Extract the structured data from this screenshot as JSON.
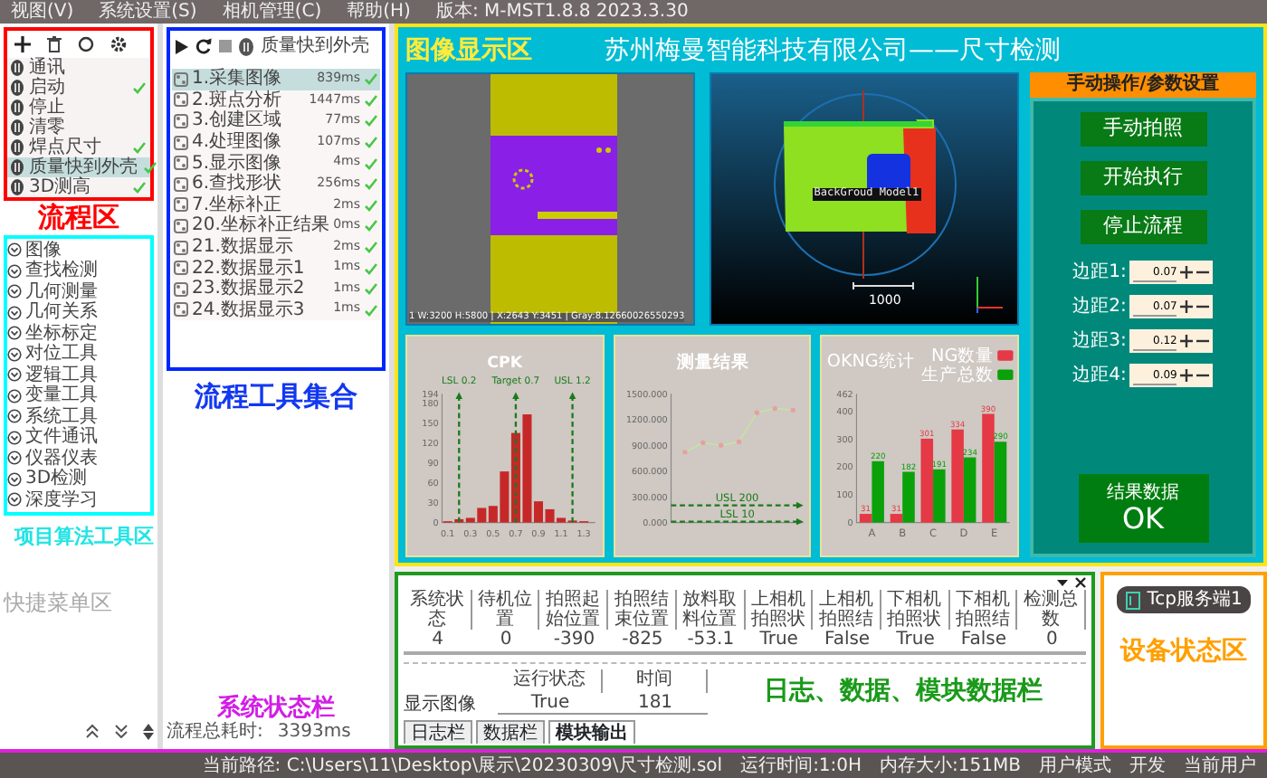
{
  "menu_bar": {
    "items": [
      "视图(V)",
      "系统设置(S)",
      "相机管理(C)",
      "帮助(H)"
    ],
    "version": "版本: M-MST1.8.8 2023.3.30"
  },
  "flow_area": {
    "label": "流程区",
    "flows": [
      {
        "name": "通讯",
        "checked": false,
        "selected": false
      },
      {
        "name": "启动",
        "checked": true,
        "selected": false
      },
      {
        "name": "停止",
        "checked": false,
        "selected": false
      },
      {
        "name": "清零",
        "checked": false,
        "selected": false
      },
      {
        "name": "焊点尺寸",
        "checked": true,
        "selected": false
      },
      {
        "name": "质量快到外壳",
        "checked": true,
        "selected": true
      },
      {
        "name": "3D测高",
        "checked": true,
        "selected": false
      }
    ]
  },
  "algorithm_tools": {
    "label": "项目算法工具区",
    "items": [
      "图像",
      "查找检测",
      "几何测量",
      "几何关系",
      "坐标标定",
      "对位工具",
      "逻辑工具",
      "变量工具",
      "系统工具",
      "文件通讯",
      "仪器仪表",
      "3D检测",
      "深度学习"
    ]
  },
  "shortcut_menu": {
    "label": "快捷菜单区"
  },
  "process_tools": {
    "header": "质量快到外壳",
    "label": "流程工具集合",
    "tools": [
      {
        "name": "1.采集图像",
        "time": "839ms",
        "checked": true,
        "selected": true
      },
      {
        "name": "2.斑点分析",
        "time": "1447ms",
        "checked": true,
        "selected": false
      },
      {
        "name": "3.创建区域",
        "time": "77ms",
        "checked": true,
        "selected": false
      },
      {
        "name": "4.处理图像",
        "time": "107ms",
        "checked": true,
        "selected": false
      },
      {
        "name": "5.显示图像",
        "time": "4ms",
        "checked": true,
        "selected": false
      },
      {
        "name": "6.查找形状",
        "time": "256ms",
        "checked": true,
        "selected": false
      },
      {
        "name": "7.坐标补正",
        "time": "2ms",
        "checked": true,
        "selected": false
      },
      {
        "name": "20.坐标补正结果",
        "time": "0ms",
        "checked": true,
        "selected": false
      },
      {
        "name": "21.数据显示",
        "time": "2ms",
        "checked": true,
        "selected": false
      },
      {
        "name": "22.数据显示1",
        "time": "1ms",
        "checked": true,
        "selected": false
      },
      {
        "name": "23.数据显示2",
        "time": "1ms",
        "checked": true,
        "selected": false
      },
      {
        "name": "24.数据显示3",
        "time": "1ms",
        "checked": true,
        "selected": false
      }
    ],
    "total_time_label": "流程总耗时:",
    "total_time": "3393ms"
  },
  "system_status_label": "系统状态栏",
  "display": {
    "label": "图像显示区",
    "title": "苏州梅曼智能科技有限公司——尺寸检测",
    "image_info": "1 W:3200 H:5800 | X:2643 Y:3451 | Gray:8.12660026550293",
    "model_label": "BackGroud Model1",
    "scale_label": "1000",
    "charts": [
      {
        "chart_data": {
          "type": "bar",
          "title": "CPK",
          "x": [
            0.1,
            0.2,
            0.3,
            0.4,
            0.5,
            0.6,
            0.7,
            0.8,
            0.9,
            1.0,
            1.1,
            1.2,
            1.3
          ],
          "values": [
            2,
            5,
            7,
            22,
            25,
            77,
            135,
            163,
            32,
            20,
            7,
            3,
            2
          ],
          "xlim": [
            0.05,
            1.4
          ],
          "ylim": [
            0,
            194
          ],
          "xticks": [
            0.1,
            0.3,
            0.5,
            0.7,
            0.9,
            1.1,
            1.3
          ],
          "yticks": [
            0,
            30,
            60,
            90,
            120,
            150,
            180,
            194
          ],
          "ref_lines": [
            {
              "axis": "x",
              "value": 0.2,
              "label": "LSL 0.2"
            },
            {
              "axis": "x",
              "value": 0.7,
              "label": "Target 0.7"
            },
            {
              "axis": "x",
              "value": 1.2,
              "label": "USL 1.2"
            }
          ]
        }
      },
      {
        "chart_data": {
          "type": "line",
          "title": "测量结果",
          "values": [
            820,
            930,
            900,
            940,
            1280,
            1330,
            1310
          ],
          "ylim": [
            0,
            1500
          ],
          "yticks": [
            {
              "value": 0,
              "label": "0.000"
            },
            {
              "value": 300,
              "label": "300.000"
            },
            {
              "value": 600,
              "label": "600.000"
            },
            {
              "value": 900,
              "label": "900.000"
            },
            {
              "value": 1200,
              "label": "1200.000"
            },
            {
              "value": 1500,
              "label": "1500.000"
            }
          ],
          "ref_lines": [
            {
              "axis": "y",
              "value": 200,
              "label": "USL 200"
            },
            {
              "axis": "y",
              "value": 10,
              "label": "LSL 10"
            }
          ]
        }
      },
      {
        "chart_data": {
          "type": "bar",
          "title": "OKNG统计",
          "categories": [
            "A",
            "B",
            "C",
            "D",
            "E"
          ],
          "series": [
            {
              "name": "NG数量",
              "color": "#e53945",
              "values": [
                31,
                31,
                301,
                334,
                390
              ]
            },
            {
              "name": "生产总数",
              "color": "#0aa10a",
              "values": [
                220,
                182,
                191,
                234,
                290
              ]
            }
          ],
          "ylim": [
            0,
            462
          ],
          "yticks": [
            0,
            100,
            200,
            300,
            400,
            462
          ],
          "data_labels": true,
          "legend": "top-right"
        }
      }
    ]
  },
  "control_panel": {
    "header": "手动操作/参数设置",
    "buttons": [
      "手动拍照",
      "开始执行",
      "停止流程"
    ],
    "params": [
      {
        "label": "边距1:",
        "value": "0.07"
      },
      {
        "label": "边距2:",
        "value": "0.07"
      },
      {
        "label": "边距3:",
        "value": "0.12"
      },
      {
        "label": "边距4:",
        "value": "0.09"
      }
    ],
    "result_label": "结果数据",
    "result": "OK"
  },
  "log_panel": {
    "label": "日志、数据、模块数据栏",
    "table": {
      "columns": [
        "系统状态",
        "待机位置",
        "拍照起始位置",
        "拍照结束位置",
        "放料取料位置",
        "上相机拍照状",
        "上相机拍照结",
        "下相机拍照状",
        "下相机拍照结",
        "检测总数"
      ],
      "values": [
        "4",
        "0",
        "-390",
        "-825",
        "-53.1",
        "True",
        "False",
        "True",
        "False",
        "0"
      ]
    },
    "sub_table": {
      "row_label": "显示图像",
      "columns": [
        "运行状态",
        "时间"
      ],
      "values": [
        "True",
        "181"
      ]
    },
    "tabs": [
      {
        "label": "日志栏",
        "selected": false
      },
      {
        "label": "数据栏",
        "selected": false
      },
      {
        "label": "模块输出",
        "selected": true
      }
    ]
  },
  "device_area": {
    "label": "设备状态区",
    "devices": [
      "Tcp服务端1"
    ]
  },
  "status_bar": {
    "items": [
      "当前路径: C:\\Users\\11\\Desktop\\展示\\20230309\\尺寸检测.sol",
      "运行时间:1:0H",
      "内存大小:151MB",
      "用户模式",
      "开发",
      "当前用户"
    ]
  }
}
